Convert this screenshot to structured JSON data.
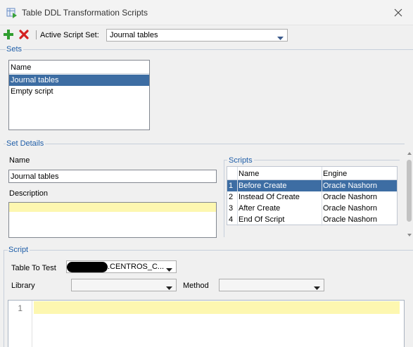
{
  "window": {
    "title": "Table DDL Transformation Scripts",
    "icon": "table-script-icon",
    "close_icon": "close-icon"
  },
  "toolbar": {
    "add_icon": "plus-icon",
    "delete_icon": "delete-x-icon",
    "active_set_label": "Active Script Set:",
    "active_set_value": "Journal tables"
  },
  "sets": {
    "title": "Sets",
    "column_header": "Name",
    "items": [
      {
        "label": "Journal tables",
        "selected": true
      },
      {
        "label": "Empty script",
        "selected": false
      }
    ]
  },
  "set_details": {
    "title": "Set Details",
    "name_label": "Name",
    "name_value": "Journal tables",
    "description_label": "Description",
    "description_value": ""
  },
  "scripts": {
    "title": "Scripts",
    "columns": [
      "",
      "Name",
      "Engine"
    ],
    "rows": [
      {
        "num": "1",
        "name": "Before Create",
        "engine": "Oracle Nashorn",
        "selected": true
      },
      {
        "num": "2",
        "name": "Instead Of Create",
        "engine": "Oracle Nashorn",
        "selected": false
      },
      {
        "num": "3",
        "name": "After Create",
        "engine": "Oracle Nashorn",
        "selected": false
      },
      {
        "num": "4",
        "name": "End Of Script",
        "engine": "Oracle Nashorn",
        "selected": false
      }
    ]
  },
  "script": {
    "title": "Script",
    "table_to_test_label": "Table To Test",
    "table_to_test_value": ".CENTROS_C...",
    "library_label": "Library",
    "library_value": "",
    "method_label": "Method",
    "method_value": "",
    "editor_line_number": "1"
  },
  "colors": {
    "selection": "#3d6da3",
    "section_title": "#1f5ea8",
    "highlight_line": "#fdf7b0"
  }
}
